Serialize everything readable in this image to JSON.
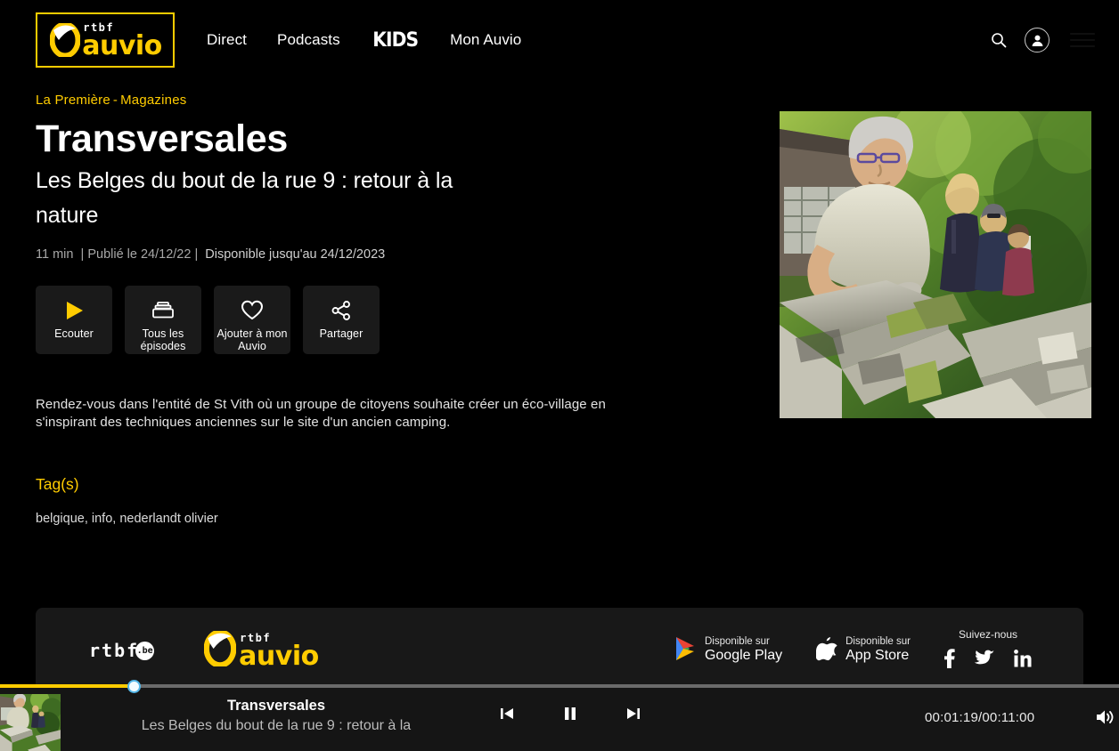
{
  "brand": {
    "logo_rtbf": "rtbf",
    "logo_auvio": "auvio",
    "logo_alt": "rtbf auvio"
  },
  "header": {
    "nav": [
      {
        "label": "Direct",
        "name": "nav-direct"
      },
      {
        "label": "Podcasts",
        "name": "nav-podcasts"
      },
      {
        "label": "KIDS",
        "name": "nav-kids"
      },
      {
        "label": "Mon Auvio",
        "name": "nav-mon-auvio"
      }
    ],
    "search_icon": "search-icon",
    "account_icon": "user-account-icon"
  },
  "content": {
    "breadcrumb": {
      "channel": "La Première",
      "separator": "-",
      "category": "Magazines"
    },
    "title": "Transversales",
    "subtitle": "Les Belges du bout de la rue 9 : retour à la nature",
    "meta": {
      "duration": "11 min",
      "sep1": "|",
      "published": "Publié le 24/12/22",
      "sep2": "|",
      "available": "Disponible jusqu'au 24/12/2023"
    },
    "actions": [
      {
        "label": "Ecouter",
        "icon": "play-icon",
        "name": "listen-button"
      },
      {
        "label": "Tous les épisodes",
        "icon": "episodes-icon",
        "name": "all-episodes-button"
      },
      {
        "label": "Ajouter à mon Auvio",
        "icon": "heart-icon",
        "name": "add-to-my-auvio-button"
      },
      {
        "label": "Partager",
        "icon": "share-icon",
        "name": "share-button"
      }
    ],
    "description": "Rendez-vous dans l'entité de St Vith où un groupe de citoyens souhaite créer un éco-village en s'inspirant des techniques anciennes sur le site d'un ancien camping.",
    "tags_heading": "Tag(s)",
    "tags": "belgique, info, nederlandt olivier"
  },
  "footer": {
    "rtbf_be": "rtbf",
    "be_suffix": ".be",
    "auvio_rtbf": "rtbf",
    "auvio_word": "auvio",
    "stores": [
      {
        "small": "Disponible sur",
        "big": "Google Play",
        "icon": "google-play-icon",
        "name": "google-play-badge"
      },
      {
        "small": "Disponible sur",
        "big": "App Store",
        "icon": "apple-icon",
        "name": "app-store-badge"
      }
    ],
    "follow_label": "Suivez-nous",
    "socials": [
      {
        "icon": "facebook-icon",
        "name": "social-facebook"
      },
      {
        "icon": "twitter-icon",
        "name": "social-twitter"
      },
      {
        "icon": "linkedin-icon",
        "name": "social-linkedin"
      }
    ]
  },
  "player": {
    "title": "Transversales",
    "subtitle": "Les Belges du bout de la rue 9 : retour à la",
    "time": "00:01:19/00:11:00",
    "progress_percent": 12,
    "controls": [
      {
        "icon": "previous-track-icon",
        "name": "previous-button"
      },
      {
        "icon": "pause-icon",
        "name": "pause-button"
      },
      {
        "icon": "next-track-icon",
        "name": "next-button"
      }
    ],
    "volume_icon": "volume-icon"
  },
  "colors": {
    "accent": "#ffcc00",
    "background": "#000000",
    "panel": "#181818",
    "player_bg": "#151515",
    "handle": "#53b6e8"
  }
}
